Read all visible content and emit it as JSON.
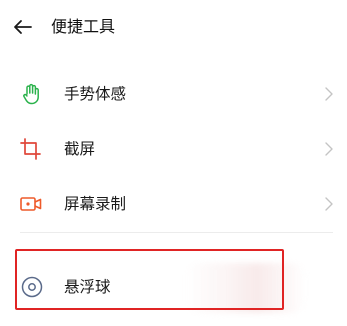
{
  "header": {
    "title": "便捷工具",
    "back_icon": "back-arrow-icon"
  },
  "list": {
    "items": [
      {
        "label": "手势体感",
        "icon": "hand-gesture-icon",
        "icon_color": "#2bb24c"
      },
      {
        "label": "截屏",
        "icon": "crop-screenshot-icon",
        "icon_color": "#e0473a"
      },
      {
        "label": "屏幕录制",
        "icon": "video-record-icon",
        "icon_color": "#ee5a2a"
      }
    ]
  },
  "float_ball": {
    "label": "悬浮球",
    "icon": "floating-ball-icon",
    "icon_color": "#5a6a8a"
  },
  "colors": {
    "highlight": "#e02424",
    "chevron": "#c4c4c4"
  }
}
